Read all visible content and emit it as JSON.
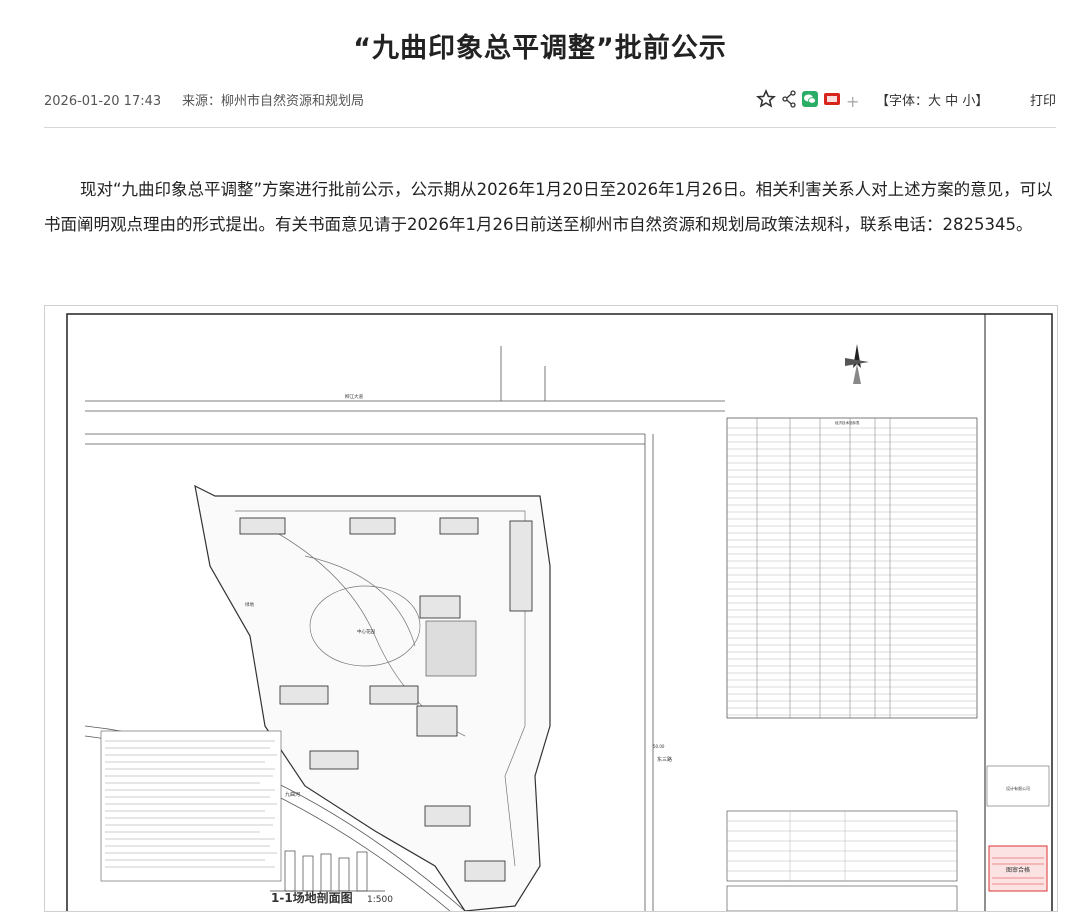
{
  "article": {
    "title": "“九曲印象总平调整”批前公示",
    "date": "2026-01-20 17:43",
    "source": "来源：柳州市自然资源和规划局",
    "font_label_open": "【字体：",
    "font_large": "大",
    "font_medium": "中",
    "font_small": "小",
    "font_label_close": "】",
    "print_label": "打印",
    "plus_sign": "+",
    "body": "现对“九曲印象总平调整”方案进行批前公示，公示期从2026年1月20日至2026年1月26日。相关利害关系人对上述方案的意见，可以书面阐明观点理由的形式提出。有关书面意见请于2026年1月26日前送至柳州市自然资源和规划局政策法规科，联系电话：2825345。"
  },
  "share_icons": [
    "star-icon",
    "share-icon",
    "wechat-icon",
    "weibo-icon"
  ],
  "colors": {
    "wechat_green": "#2aae67",
    "weibo_red": "#d9241c",
    "divider": "#d8d8d8"
  },
  "figure": {
    "road_label_top": "柳江大道",
    "road_label_right": "东三路",
    "area_label_left": "九曲河",
    "center_label": "中心花园",
    "green_label": "绿地",
    "section_title": "1-1场地剖面图",
    "section_scale": "1:500",
    "dimension_label": "50.00",
    "stamp_label": "图审合格",
    "company_label": "设计有限公司",
    "table_title": "经济技术指标表"
  }
}
